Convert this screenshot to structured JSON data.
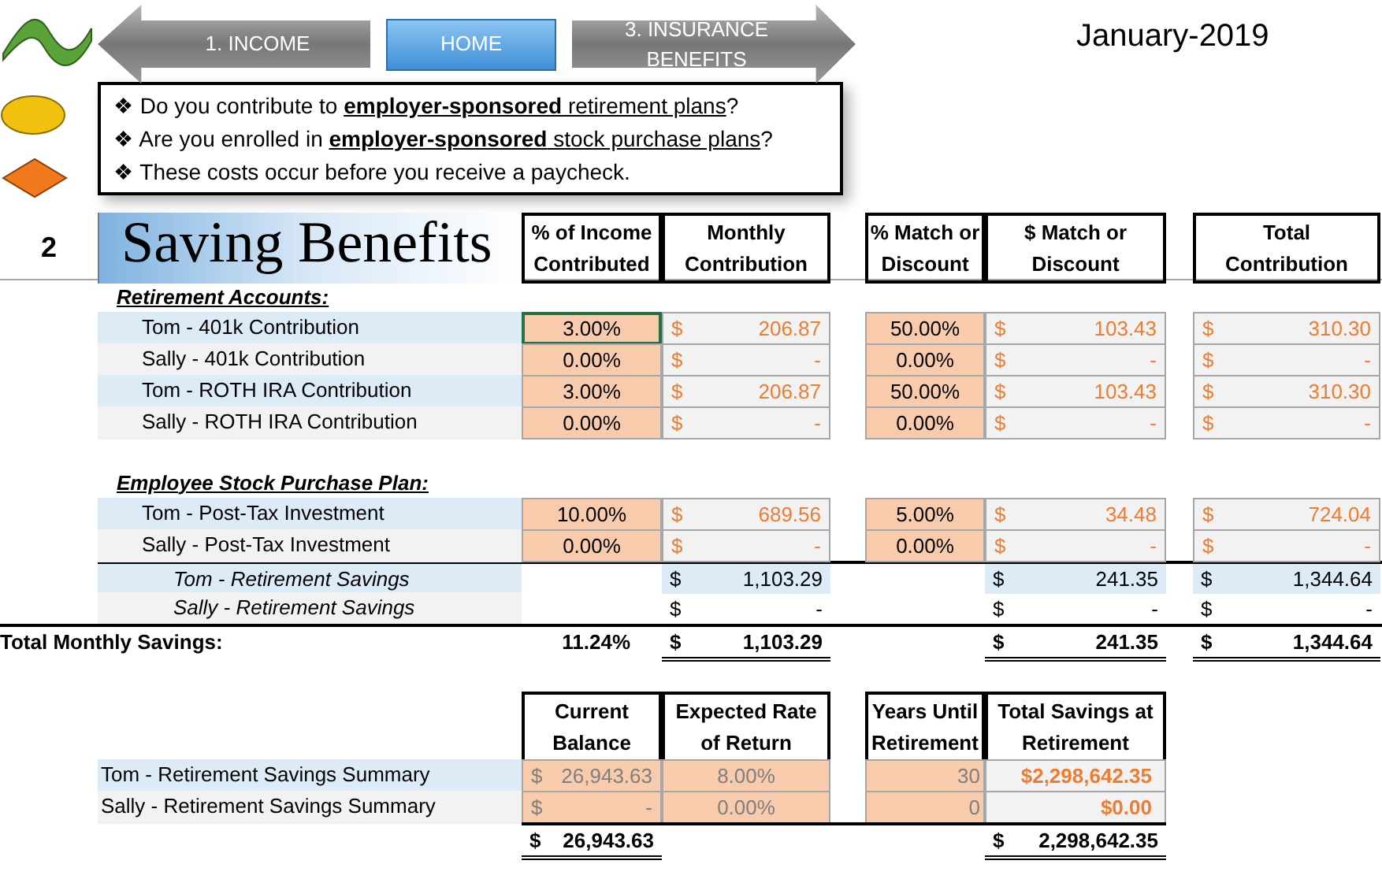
{
  "nav": [
    {
      "label": "1. INCOME",
      "kind": "back"
    },
    {
      "label": "HOME",
      "kind": "home"
    },
    {
      "label": "3. INSURANCE BENEFITS",
      "kind": "forward"
    }
  ],
  "date": "January-2019",
  "notes": [
    {
      "bullet": "❖",
      "lead": " Do you contribute to ",
      "underlined": "**employer-sponsored** retirement plans",
      "tail": "?"
    },
    {
      "bullet": "❖",
      "lead": "Are you enrolled in ",
      "underlined": "**employer-sponsored** stock purchase plans",
      "tail": "?"
    },
    {
      "bullet": "❖",
      "lead": "These costs occur before you receive a paycheck."
    }
  ],
  "section": {
    "number": "2",
    "title": "Saving Benefits"
  },
  "columns": [
    [
      "% of Income",
      "Contributed"
    ],
    [
      "Monthly",
      "Contribution"
    ],
    [
      "% Match or",
      "Discount"
    ],
    [
      "$ Match or",
      "Discount"
    ],
    [
      "Total",
      "Contribution"
    ]
  ],
  "groups": [
    {
      "heading": "Retirement Accounts:",
      "rows": [
        {
          "kind": "input",
          "label": "Tom - 401k Contribution",
          "pct": "3.00%",
          "selected": true,
          "monthly": [
            "$",
            "206.87"
          ],
          "match_pct": "50.00%",
          "match_amt": [
            "$",
            "103.43"
          ],
          "total": [
            "$",
            "310.30"
          ]
        },
        {
          "kind": "input",
          "label": "Sally - 401k Contribution",
          "pct": "0.00%",
          "selected": false,
          "monthly": [
            "$",
            "-"
          ],
          "match_pct": "0.00%",
          "match_amt": [
            "$",
            "-"
          ],
          "total": [
            "$",
            "-"
          ]
        },
        {
          "kind": "input",
          "label": "Tom - ROTH IRA Contribution",
          "pct": "3.00%",
          "selected": false,
          "monthly": [
            "$",
            "206.87"
          ],
          "match_pct": "50.00%",
          "match_amt": [
            "$",
            "103.43"
          ],
          "total": [
            "$",
            "310.30"
          ]
        },
        {
          "kind": "input",
          "label": "Sally - ROTH IRA Contribution",
          "pct": "0.00%",
          "selected": false,
          "monthly": [
            "$",
            "-"
          ],
          "match_pct": "0.00%",
          "match_amt": [
            "$",
            "-"
          ],
          "total": [
            "$",
            "-"
          ]
        }
      ]
    },
    {
      "heading": "Employee Stock Purchase Plan:",
      "rows": [
        {
          "kind": "input",
          "label": "Tom - Post-Tax Investment",
          "pct": "10.00%",
          "selected": false,
          "monthly": [
            "$",
            "689.56"
          ],
          "match_pct": "5.00%",
          "match_amt": [
            "$",
            "34.48"
          ],
          "total": [
            "$",
            "724.04"
          ]
        },
        {
          "kind": "input",
          "label": "Sally - Post-Tax Investment",
          "pct": "0.00%",
          "selected": false,
          "monthly": [
            "$",
            "-"
          ],
          "match_pct": "0.00%",
          "match_amt": [
            "$",
            "-"
          ],
          "total": [
            "$",
            "-"
          ]
        },
        {
          "kind": "subtotal",
          "label": "Tom - Retirement Savings",
          "monthly": [
            "$",
            "1,103.29"
          ],
          "match_amt": [
            "$",
            "241.35"
          ],
          "total": [
            "$",
            "1,344.64"
          ]
        },
        {
          "kind": "subtotal",
          "label": "Sally - Retirement Savings",
          "monthly": [
            "$",
            "-"
          ],
          "match_amt": [
            "$",
            "-"
          ],
          "total": [
            "$",
            "-"
          ]
        }
      ]
    }
  ],
  "total_row": {
    "label": "Total Monthly Savings:",
    "pct": "11.24%",
    "monthly": [
      "$",
      "1,103.29"
    ],
    "match_amt": [
      "$",
      "241.35"
    ],
    "total": [
      "$",
      "1,344.64"
    ]
  },
  "summary": {
    "columns": [
      [
        "Current",
        "Balance"
      ],
      [
        "Expected Rate",
        "of Return"
      ],
      [
        "Years Until",
        "Retirement"
      ],
      [
        "Total Savings at",
        "Retirement"
      ]
    ],
    "rows": [
      {
        "label": "Tom - Retirement Savings Summary",
        "balance": [
          "$",
          "26,943.63"
        ],
        "rate": "8.00%",
        "years": "30",
        "total": "$2,298,642.35"
      },
      {
        "label": "Sally - Retirement Savings Summary",
        "balance": [
          "$",
          "-"
        ],
        "rate": "0.00%",
        "years": "0",
        "total": "$0.00"
      }
    ],
    "totals": {
      "balance": [
        "$",
        "26,943.63"
      ],
      "total": [
        "$",
        "2,298,642.35"
      ]
    }
  }
}
